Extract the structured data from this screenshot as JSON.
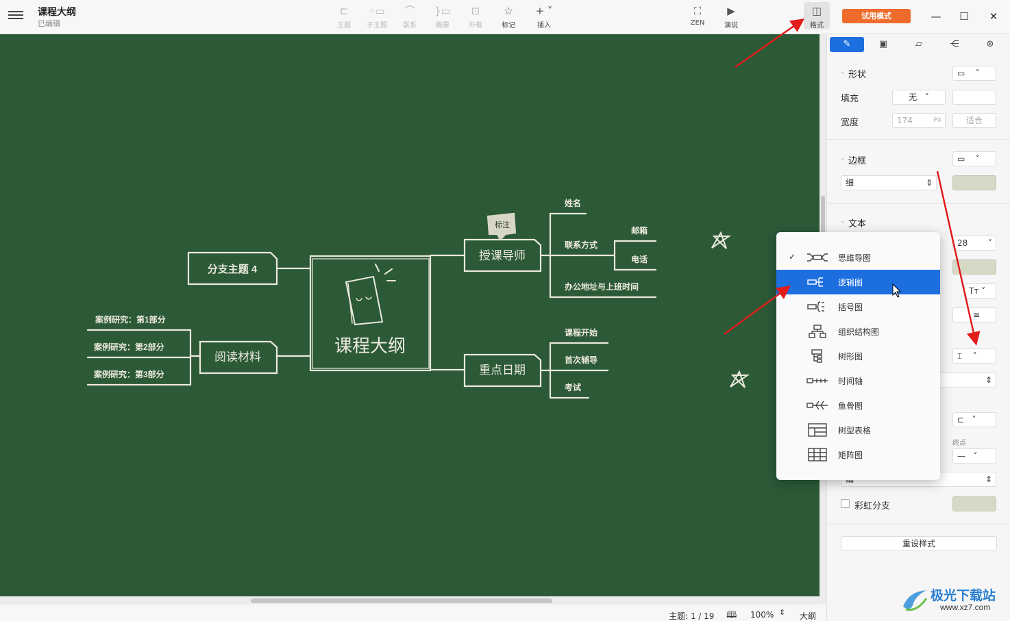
{
  "window": {
    "title": "课程大纲",
    "status": "已编辑",
    "trial_label": "试用模式"
  },
  "toolbar": {
    "topic": "主题",
    "subtopic": "子主题",
    "relation": "联系",
    "summary": "概要",
    "boundary": "外框",
    "marker": "标记",
    "insert": "插入",
    "zen": "ZEN",
    "present": "演说",
    "format": "格式"
  },
  "mindmap": {
    "central": "课程大纲",
    "branch_left_top": "分支主题 4",
    "branch_left_bottom": "阅读材料",
    "case1": "案例研究：第1部分",
    "case2": "案例研究：第2部分",
    "case3": "案例研究：第3部分",
    "branch_right_top": "授课导师",
    "callout": "标注",
    "name": "姓名",
    "contact": "联系方式",
    "email": "邮箱",
    "phone": "电话",
    "office": "办公地址与上班时间",
    "branch_right_bottom": "重点日期",
    "course_start": "课程开始",
    "first_tutoring": "首次辅导",
    "exam": "考试"
  },
  "panel": {
    "shape": {
      "title": "形状",
      "fill_label": "填充",
      "fill_value": "无",
      "width_label": "宽度",
      "width_value": "174",
      "width_unit": "PX",
      "fit_label": "适合"
    },
    "border": {
      "title": "边框",
      "thickness": "细"
    },
    "text": {
      "title": "文本",
      "size": "28",
      "case_label": "Tт"
    },
    "line_end_label": "终点",
    "line_thickness": "细",
    "rainbow_label": "彩虹分支",
    "reset_label": "重设样式"
  },
  "structure_menu": {
    "items": [
      {
        "label": "思维导图",
        "checked": true
      },
      {
        "label": "逻辑图",
        "highlighted": true
      },
      {
        "label": "括号图"
      },
      {
        "label": "组织结构图"
      },
      {
        "label": "树形图"
      },
      {
        "label": "时间轴"
      },
      {
        "label": "鱼骨图"
      },
      {
        "label": "树型表格"
      },
      {
        "label": "矩阵图"
      }
    ]
  },
  "statusbar": {
    "topic_count": "主题: 1 / 19",
    "zoom": "100%",
    "outline": "大纲"
  },
  "watermark": {
    "brand": "极光下载站",
    "url": "www.xz7.com"
  },
  "colors": {
    "canvas": "#2c5a37",
    "chalk": "#ece9dc",
    "accent": "#1d6fe0",
    "trial": "#ef6b2b",
    "annotation_arrow": "#e21b1b"
  }
}
